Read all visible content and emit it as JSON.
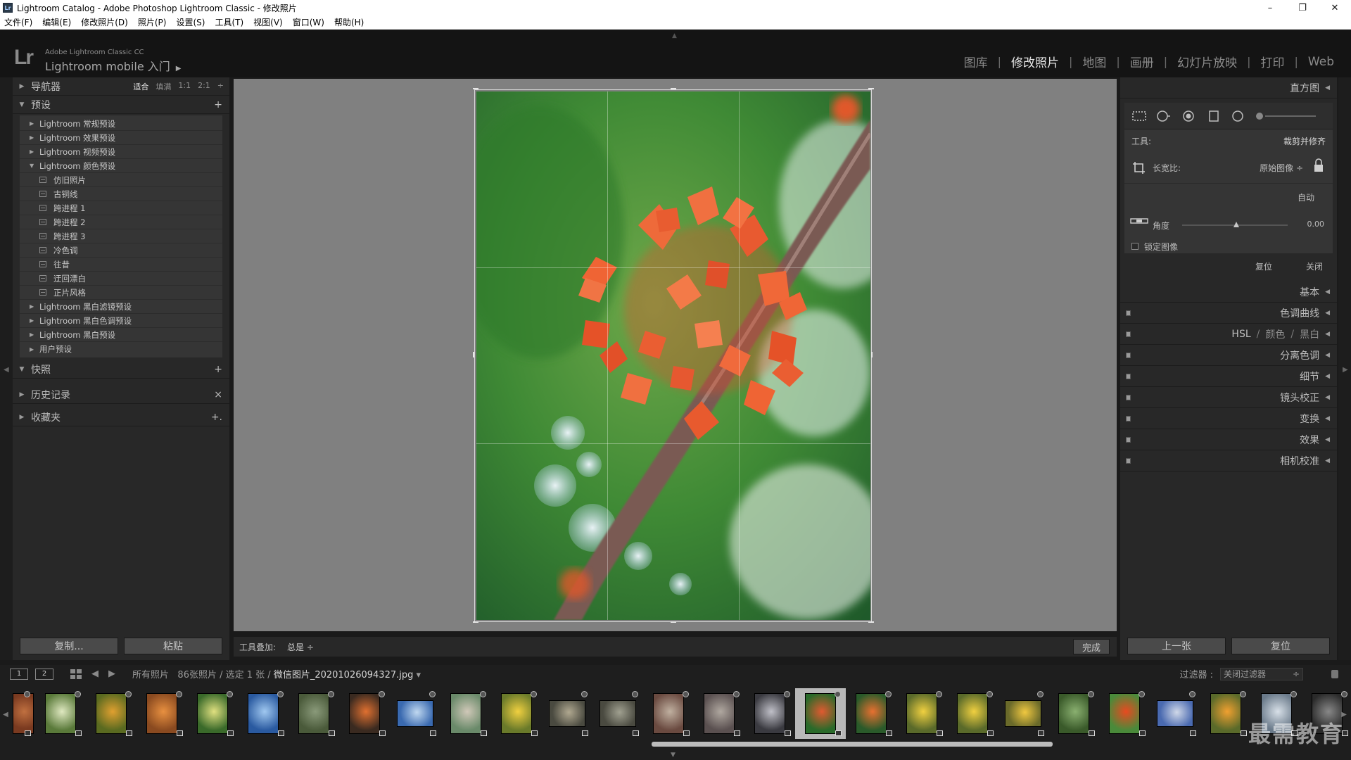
{
  "window": {
    "title": "Lightroom Catalog - Adobe Photoshop Lightroom Classic - 修改照片",
    "app_icon": "Lr",
    "minimize": "–",
    "restore": "❐",
    "close": "✕"
  },
  "menu": [
    "文件(F)",
    "编辑(E)",
    "修改照片(D)",
    "照片(P)",
    "设置(S)",
    "工具(T)",
    "视图(V)",
    "窗口(W)",
    "帮助(H)"
  ],
  "identity": {
    "logo": "Lr",
    "subtitle": "Adobe Lightroom Classic CC",
    "main": "Lightroom mobile 入门",
    "arrow": "▶"
  },
  "modules": [
    "图库",
    "修改照片",
    "地图",
    "画册",
    "幻灯片放映",
    "打印",
    "Web"
  ],
  "active_module": "修改照片",
  "left_panel": {
    "navigator": {
      "label": "导航器",
      "zoom": [
        "适合",
        "填满",
        "1:1",
        "2:1"
      ],
      "zoom_more": "÷"
    },
    "presets": {
      "label": "预设",
      "add": "+",
      "groups": [
        "Lightroom 常规预设",
        "Lightroom 效果预设",
        "Lightroom 视频预设",
        "Lightroom 颜色预设"
      ],
      "color_presets": [
        "仿旧照片",
        "古铜线",
        "跨进程 1",
        "跨进程 2",
        "跨进程 3",
        "冷色调",
        "往昔",
        "迂回漂白",
        "正片风格"
      ],
      "groups_after": [
        "Lightroom 黑白滤镜预设",
        "Lightroom 黑白色调预设",
        "Lightroom 黑白预设",
        "用户预设"
      ]
    },
    "snapshots": {
      "label": "快照",
      "action": "+"
    },
    "history": {
      "label": "历史记录",
      "action": "×"
    },
    "collections": {
      "label": "收藏夹",
      "action": "+."
    },
    "copy_button": "复制...",
    "paste_button": "粘贴"
  },
  "toolbar": {
    "overlay_label": "工具叠加:",
    "overlay_value": "总是 ÷",
    "done": "完成"
  },
  "right_panel": {
    "histogram": "直方图",
    "crop": {
      "tool_label": "工具:",
      "tool_name": "裁剪并修齐",
      "aspect_label": "长宽比:",
      "aspect_value": "原始图像 ÷",
      "auto": "自动",
      "angle_label": "角度",
      "angle_value": "0.00",
      "angle_fraction": 0.5,
      "constrain_label": "锁定图像",
      "reset": "复位",
      "close": "关闭"
    },
    "basic": "基本",
    "tone_curve": "色调曲线",
    "hsl": "HSL",
    "color": "颜色",
    "bw": "黑白",
    "split_toning": "分离色调",
    "detail": "细节",
    "lens": "镜头校正",
    "transform": "变换",
    "effects": "效果",
    "calibration": "相机校准",
    "prev_button": "上一张",
    "reset_button": "复位"
  },
  "filmstrip": {
    "screen1": "1",
    "screen2": "2",
    "source": "所有照片",
    "count": "86张照片 / 选定 1 张 /",
    "filename": "微信图片_20201026094327.jpg",
    "filename_arrow": "▾",
    "filter_label": "过滤器 :",
    "filter_value": "关闭过滤器",
    "filter_arrow": "÷",
    "selected_index": 16
  },
  "watermark": "最需教育",
  "colors": {
    "accent_active": "#e5e5e5",
    "panel_bg": "#282828",
    "canvas_bg": "#808080"
  }
}
